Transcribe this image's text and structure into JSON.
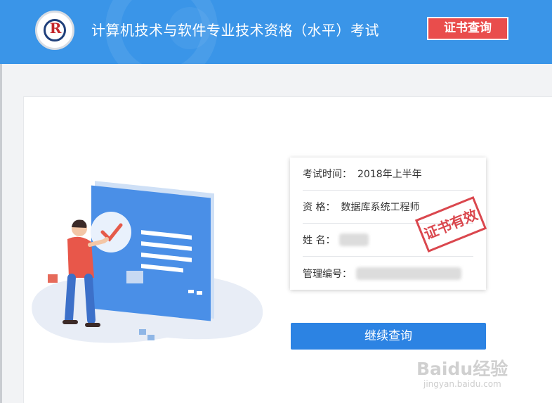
{
  "header": {
    "logo_mark": "R",
    "title": "计算机技术与软件专业技术资格（水平）考试",
    "cert_button": "证书查询"
  },
  "result": {
    "rows": [
      {
        "label": "考试时间：",
        "value": "2018年上半年"
      },
      {
        "label": "资 格：",
        "value": "数据库系统工程师"
      },
      {
        "label": "姓 名：",
        "value": ""
      },
      {
        "label": "管理编号：",
        "value": ""
      }
    ],
    "stamp": "证书有效"
  },
  "continue_button": "继续查询",
  "watermark": {
    "logo": "Baidu经验",
    "url": "jingyan.baidu.com"
  },
  "colors": {
    "header_bg": "#3a95e8",
    "cert_button_bg": "#e94d4c",
    "primary_button": "#2c83e3",
    "stamp_red": "#d7343b"
  }
}
